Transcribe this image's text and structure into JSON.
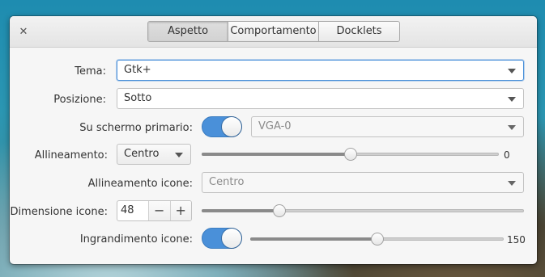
{
  "window": {
    "tabs": [
      {
        "label": "Aspetto",
        "active": true
      },
      {
        "label": "Comportamento",
        "active": false
      },
      {
        "label": "Docklets",
        "active": false
      }
    ]
  },
  "settings": {
    "tema": {
      "label": "Tema:",
      "value": "Gtk+"
    },
    "posizione": {
      "label": "Posizione:",
      "value": "Sotto"
    },
    "schermo": {
      "label": "Su schermo primario:",
      "switch_on": true,
      "value": "VGA-0"
    },
    "allineamento": {
      "label": "Allineamento:",
      "value": "Centro",
      "slider_value": "0",
      "slider_fraction": 0.5
    },
    "allineamento_icone": {
      "label": "Allineamento icone:",
      "value": "Centro"
    },
    "dimensione_icone": {
      "label": "Dimensione icone:",
      "value": "48",
      "minus": "−",
      "plus": "+",
      "slider_fraction": 0.24
    },
    "ingrandimento_icone": {
      "label": "Ingrandimento icone:",
      "switch_on": true,
      "slider_value": "150",
      "slider_fraction": 0.5
    }
  },
  "icons": {
    "close": "close-icon",
    "dropdown": "chevron-down-icon"
  },
  "colors": {
    "accent": "#4a90d9",
    "window_bg": "#f6f6f6"
  }
}
